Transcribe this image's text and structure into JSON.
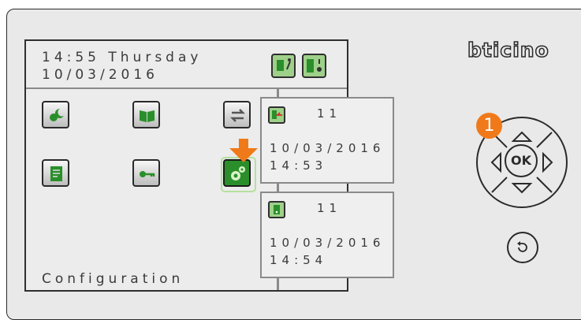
{
  "screen": {
    "time_day": "14:55 Thursday",
    "date": "10/03/2016",
    "caption": "Configuration",
    "status_icons": [
      "intercom-call-icon",
      "door-station-icon"
    ],
    "menu": [
      {
        "name": "weather-scenario-icon"
      },
      {
        "name": "open-book-icon"
      },
      {
        "name": "transfer-arrows-icon"
      },
      {
        "name": "document-icon"
      },
      {
        "name": "key-icon"
      },
      {
        "name": "gear-settings-icon",
        "selected": true
      }
    ],
    "cards": [
      {
        "icon": "missed-call-icon",
        "number": "11",
        "date": "10/03/2016",
        "time": "14:53"
      },
      {
        "icon": "door-call-icon",
        "number": "11",
        "date": "10/03/2016",
        "time": "14:54"
      }
    ]
  },
  "device": {
    "brand": "bticino",
    "ok_label": "OK",
    "step_badge": "1"
  },
  "colors": {
    "selected_tile": "#2a8f2a",
    "arrow": "#f07a1a",
    "icon_green": "#9fd08a"
  }
}
